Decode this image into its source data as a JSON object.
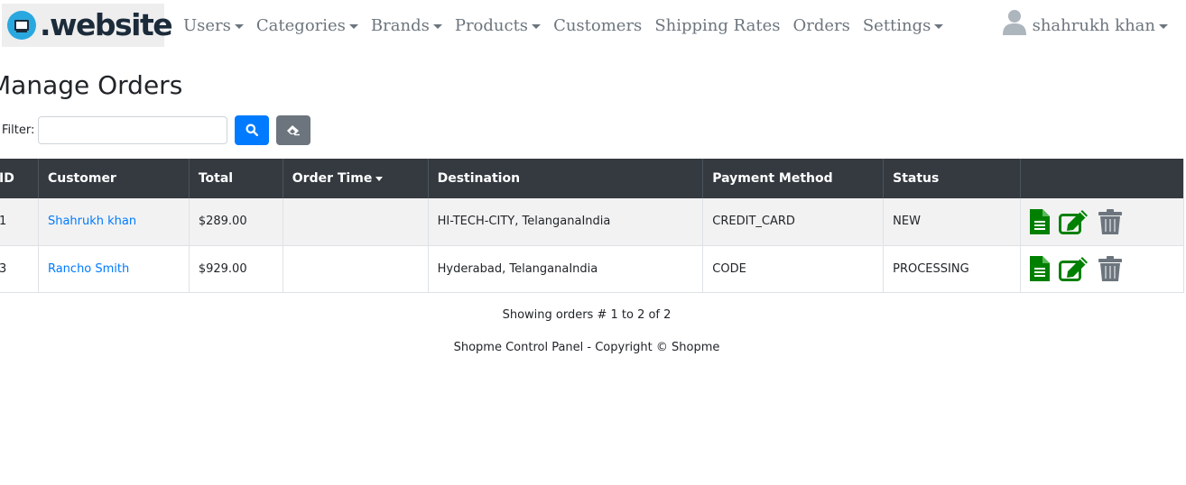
{
  "brand": {
    "logo_text": ".website"
  },
  "nav": {
    "items": [
      {
        "label": "Users",
        "dropdown": true
      },
      {
        "label": "Categories",
        "dropdown": true
      },
      {
        "label": "Brands",
        "dropdown": true
      },
      {
        "label": "Products",
        "dropdown": true
      },
      {
        "label": "Customers",
        "dropdown": false
      },
      {
        "label": "Shipping Rates",
        "dropdown": false
      },
      {
        "label": "Orders",
        "dropdown": false
      },
      {
        "label": "Settings",
        "dropdown": true
      }
    ],
    "user_name": "shahrukh khan"
  },
  "page": {
    "title": "Manage Orders",
    "filter_label": "Filter:",
    "filter_value": ""
  },
  "table": {
    "headers": [
      "ID",
      "Customer",
      "Total",
      "Order Time",
      "Destination",
      "Payment Method",
      "Status",
      ""
    ],
    "sorted_column": "Order Time",
    "rows": [
      {
        "id": "1",
        "customer": "Shahrukh khan",
        "total": "$289.00",
        "order_time": "",
        "destination": "HI-TECH-CITY, TelanganaIndia",
        "payment": "CREDIT_CARD",
        "status": "NEW"
      },
      {
        "id": "3",
        "customer": "Rancho Smith",
        "total": "$929.00",
        "order_time": "",
        "destination": "Hyderabad, TelanganaIndia",
        "payment": "CODE",
        "status": "PROCESSING"
      }
    ]
  },
  "footer": {
    "showing": "Showing orders # 1 to 2 of 2",
    "copyright": "Shopme Control Panel - Copyright © Shopme"
  },
  "colors": {
    "primary": "#007bff",
    "secondary": "#6c757d",
    "table_header": "#343a40",
    "action_green": "#008000",
    "trash_gray": "#6c757d"
  },
  "icons": {
    "search": "search-icon",
    "clear": "eraser-icon",
    "details": "file-icon",
    "edit": "edit-icon",
    "delete": "trash-icon",
    "user": "user-icon"
  }
}
